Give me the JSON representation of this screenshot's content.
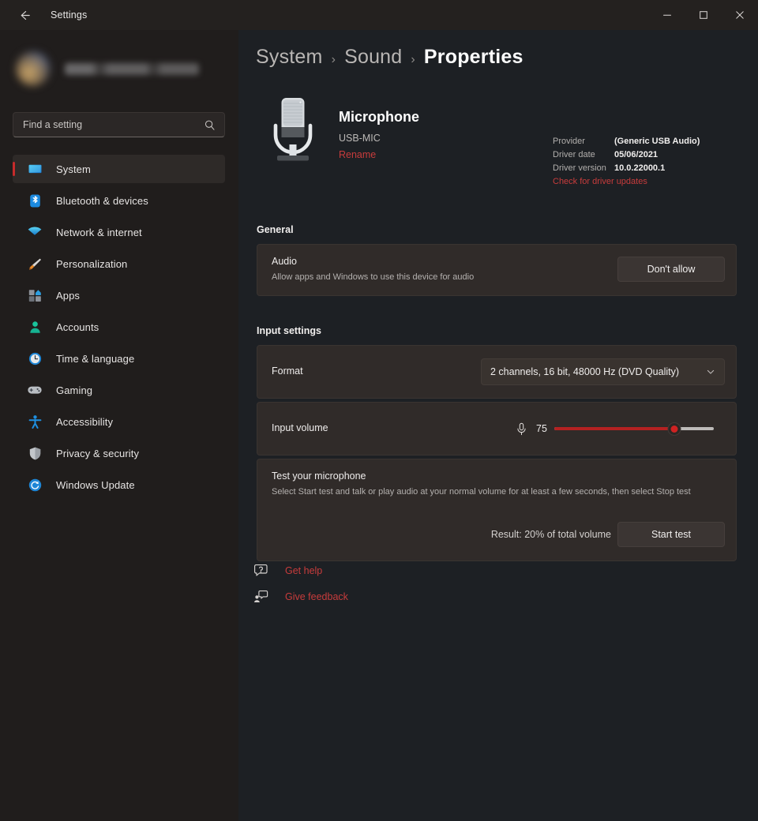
{
  "window": {
    "app_title": "Settings",
    "back_icon": "back-arrow-icon",
    "minimize_label": "—",
    "maximize_label": "☐",
    "close_label": "✕"
  },
  "sidebar": {
    "search": {
      "placeholder": "Find a setting",
      "value": "",
      "icon": "search-icon"
    },
    "items": [
      {
        "label": "System",
        "icon": "system-monitor-icon",
        "active": true
      },
      {
        "label": "Bluetooth & devices",
        "icon": "bluetooth-icon",
        "active": false
      },
      {
        "label": "Network & internet",
        "icon": "wifi-icon",
        "active": false
      },
      {
        "label": "Personalization",
        "icon": "paintbrush-icon",
        "active": false
      },
      {
        "label": "Apps",
        "icon": "apps-grid-icon",
        "active": false
      },
      {
        "label": "Accounts",
        "icon": "person-icon",
        "active": false
      },
      {
        "label": "Time & language",
        "icon": "clock-icon",
        "active": false
      },
      {
        "label": "Gaming",
        "icon": "gamepad-icon",
        "active": false
      },
      {
        "label": "Accessibility",
        "icon": "accessibility-person-icon",
        "active": false
      },
      {
        "label": "Privacy & security",
        "icon": "shield-icon",
        "active": false
      },
      {
        "label": "Windows Update",
        "icon": "update-refresh-icon",
        "active": false
      }
    ]
  },
  "breadcrumb": {
    "crumb1": "System",
    "crumb2": "Sound",
    "current": "Properties",
    "separator": "›"
  },
  "device": {
    "icon": "microphone-device-icon",
    "name": "Microphone",
    "subtitle": "USB-MIC",
    "rename_label": "Rename",
    "driver": {
      "provider_key": "Provider",
      "provider_value": "(Generic USB Audio)",
      "date_key": "Driver date",
      "date_value": "05/06/2021",
      "version_key": "Driver version",
      "version_value": "10.0.22000.1",
      "update_link": "Check for driver updates"
    }
  },
  "general": {
    "section_title": "General",
    "audio": {
      "label": "Audio",
      "description": "Allow apps and Windows to use this device for audio",
      "button_label": "Don't allow"
    }
  },
  "input_settings": {
    "section_title": "Input settings",
    "format": {
      "label": "Format",
      "value": "2 channels, 16 bit, 48000 Hz (DVD Quality)",
      "chevron_icon": "chevron-down-icon",
      "options": [
        "2 channels, 16 bit, 48000 Hz (DVD Quality)"
      ]
    },
    "volume": {
      "label": "Input volume",
      "mic_icon": "microphone-icon",
      "value": "75",
      "percent": 75,
      "min": 0,
      "max": 100
    },
    "test": {
      "label": "Test your microphone",
      "description": "Select Start test and talk or play audio at your normal volume for at least a few seconds, then select Stop test",
      "result": "Result: 20% of total volume",
      "button_label": "Start test"
    }
  },
  "footer": {
    "links": [
      {
        "label": "Get help",
        "icon": "help-question-icon"
      },
      {
        "label": "Give feedback",
        "icon": "feedback-person-icon"
      }
    ]
  },
  "colors": {
    "accent_red": "#c83c3c",
    "slider_red": "#b52121",
    "card_surface": "#302b29",
    "sidebar_bg": "#201d1c",
    "content_bg": "#1d2024"
  }
}
